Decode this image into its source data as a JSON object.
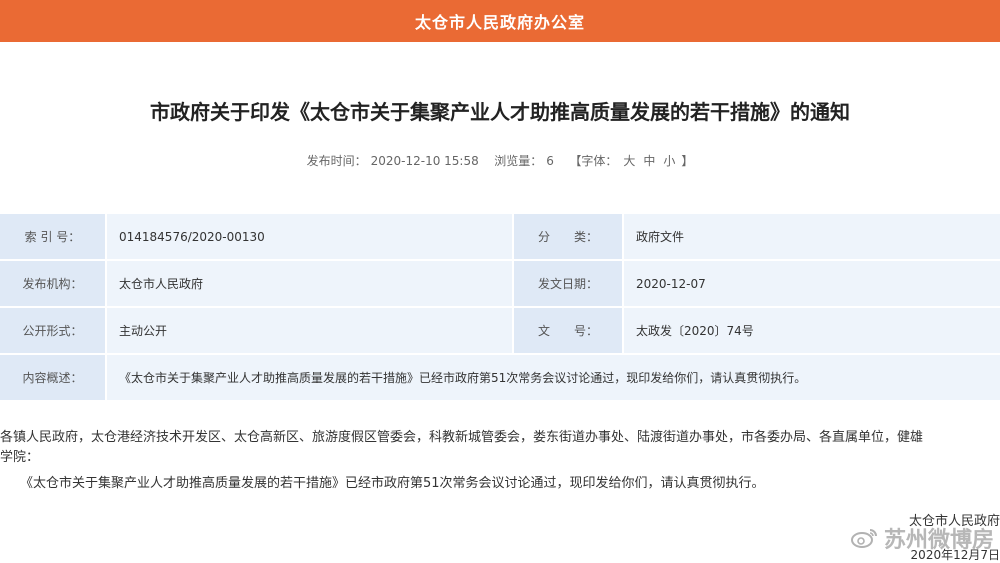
{
  "header": {
    "office_name": "太仓市人民政府办公室"
  },
  "article": {
    "title": "市政府关于印发《太仓市关于集聚产业人才助推高质量发展的若干措施》的通知",
    "meta": {
      "publish_label": "发布时间：",
      "publish_time": "2020-12-10 15:58",
      "views_label": "浏览量：",
      "views": "6",
      "font_open": "【字体：",
      "font_large": "大",
      "font_medium": "中",
      "font_small": "小",
      "font_close": "】"
    },
    "info_table": {
      "index_label": "索 引 号：",
      "index_value": "014184576/2020-00130",
      "category_label": "分　　类：",
      "category_value": "政府文件",
      "issuer_label": "发布机构：",
      "issuer_value": "太仓市人民政府",
      "date_label": "发文日期：",
      "date_value": "2020-12-07",
      "form_label": "公开形式：",
      "form_value": "主动公开",
      "docno_label": "文　　号：",
      "docno_value": "太政发〔2020〕74号",
      "summary_label": "内容概述：",
      "summary_value": "《太仓市关于集聚产业人才助推高质量发展的若干措施》已经市政府第51次常务会议讨论通过，现印发给你们，请认真贯彻执行。"
    },
    "body": {
      "recipients_line1": "各镇人民政府，太仓港经济技术开发区、太仓高新区、旅游度假区管委会，科教新城管委会，娄东街道办事处、陆渡街道办事处，市各委办局、各直属单位，健雄",
      "recipients_line2": "学院：",
      "paragraph1": "《太仓市关于集聚产业人才助推高质量发展的若干措施》已经市政府第51次常务会议讨论通过，现印发给你们，请认真贯彻执行。"
    },
    "signature": {
      "issuer": "太仓市人民政府",
      "date": "2020年12月7日"
    }
  },
  "watermark": {
    "text": "苏州微博房"
  }
}
